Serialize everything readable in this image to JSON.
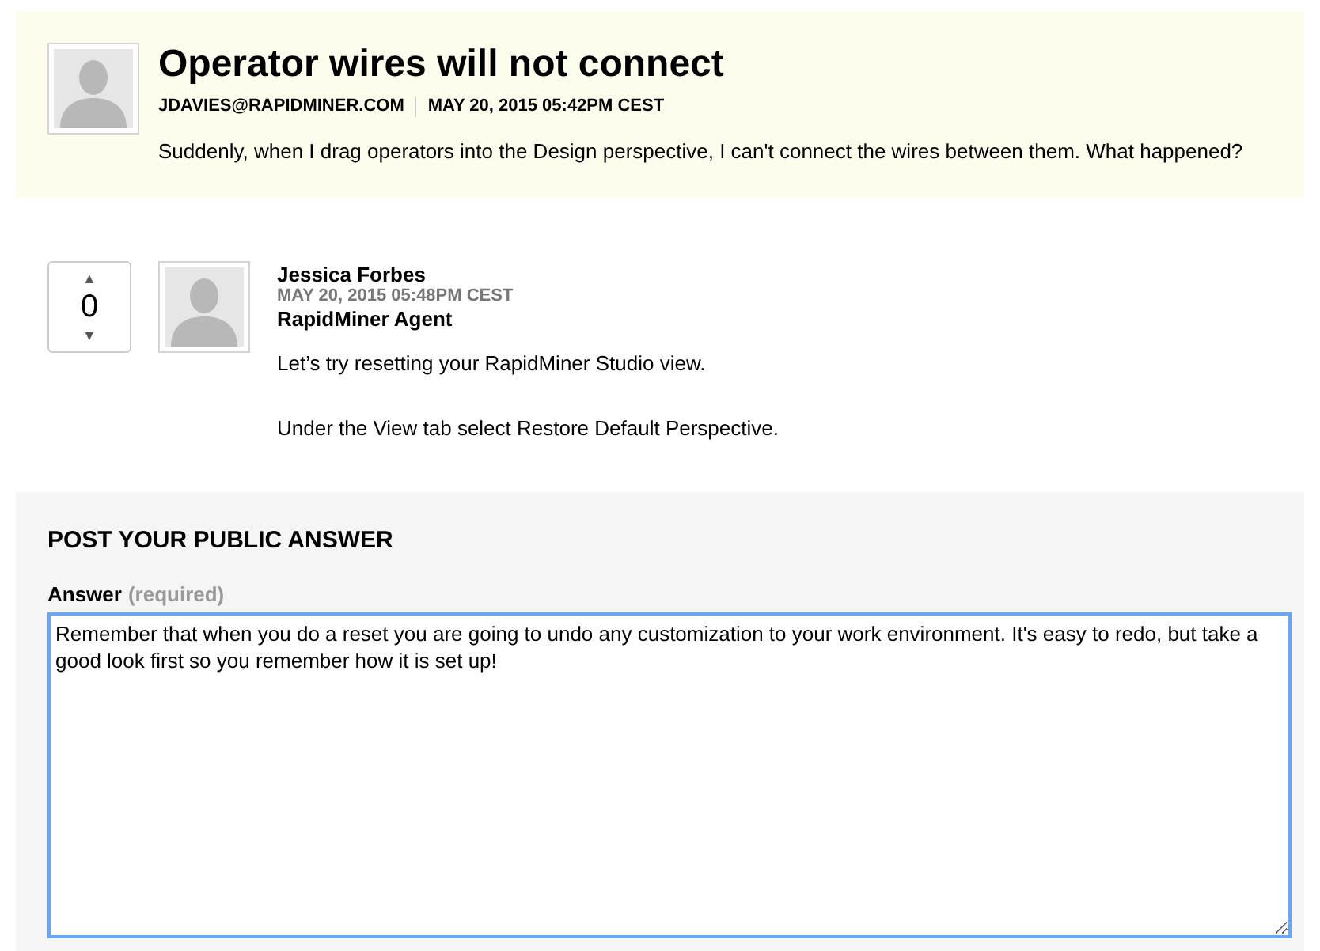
{
  "question": {
    "title": "Operator wires will not connect",
    "author": "JDAVIES@RAPIDMINER.COM",
    "date": "MAY 20, 2015 05:42PM CEST",
    "body": "Suddenly, when I drag operators into the Design perspective, I can't connect the wires between them. What happened?"
  },
  "answer": {
    "votes": "0",
    "up": "▲",
    "down": "▼",
    "author": "Jessica Forbes",
    "date": "MAY 20, 2015 05:48PM CEST",
    "role": "RapidMiner Agent",
    "paragraphs": [
      "Let’s try resetting your RapidMiner Studio view.",
      "Under the View tab select Restore Default Perspective."
    ]
  },
  "post": {
    "heading": "POST YOUR PUBLIC ANSWER",
    "label": "Answer",
    "note": "(required)",
    "value": "Remember that when you do a reset you are going to undo any customization to your work environment. It's easy to redo, but take a good look first so you remember how it is set up!",
    "focused": true
  }
}
